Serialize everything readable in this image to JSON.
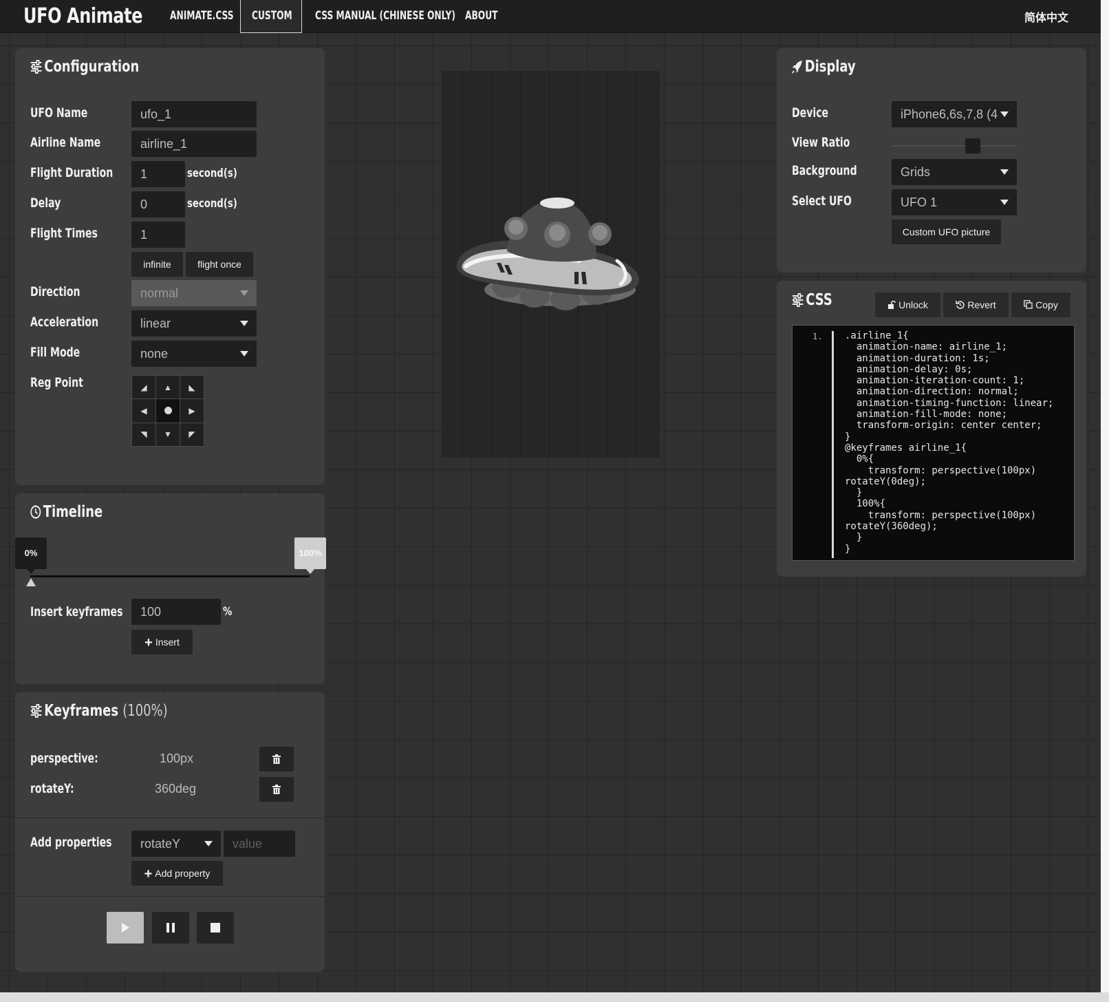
{
  "navbar": {
    "brand": "UFO Animate",
    "items": [
      "ANIMATE.CSS",
      "CUSTOM",
      "CSS MANUAL (CHINESE ONLY)",
      "ABOUT"
    ],
    "active": "CUSTOM",
    "language": "简体中文"
  },
  "configuration": {
    "title": "Configuration",
    "ufo_name": {
      "label": "UFO Name",
      "value": "ufo_1"
    },
    "airline_name": {
      "label": "Airline Name",
      "value": "airline_1"
    },
    "flight_duration": {
      "label": "Flight Duration",
      "value": "1",
      "unit": "second(s)"
    },
    "delay": {
      "label": "Delay",
      "value": "0",
      "unit": "second(s)"
    },
    "flight_times": {
      "label": "Flight Times",
      "value": "1",
      "infinite_label": "infinite",
      "once_label": "flight once"
    },
    "direction": {
      "label": "Direction",
      "value": "normal"
    },
    "acceleration": {
      "label": "Acceleration",
      "value": "linear"
    },
    "fill_mode": {
      "label": "Fill Mode",
      "value": "none"
    },
    "reg_point": {
      "label": "Reg Point",
      "selected": "center"
    }
  },
  "timeline": {
    "title": "Timeline",
    "start_label": "0%",
    "end_label": "100%",
    "selected_percent": 0,
    "insert_label": "Insert keyframes",
    "insert_value": "100",
    "insert_unit": "%",
    "insert_button": "Insert"
  },
  "keyframes": {
    "title": "Keyframes",
    "percent": "(100%)",
    "properties": [
      {
        "name": "perspective:",
        "value": "100px"
      },
      {
        "name": "rotateY:",
        "value": "360deg"
      }
    ],
    "add_label": "Add properties",
    "add_select": "rotateY",
    "add_placeholder": "value",
    "add_button": "Add property"
  },
  "playback": {
    "play_icon": "play-icon",
    "pause_icon": "pause-icon",
    "stop_icon": "stop-icon"
  },
  "display": {
    "title": "Display",
    "device": {
      "label": "Device",
      "value": "iPhone6,6s,7,8 (4"
    },
    "view_ratio": {
      "label": "View Ratio",
      "level": 0.65
    },
    "background": {
      "label": "Background",
      "value": "Grids"
    },
    "select_ufo": {
      "label": "Select UFO",
      "value": "UFO 1"
    },
    "custom_button": "Custom UFO picture"
  },
  "css_panel": {
    "title": "CSS",
    "unlock": "Unlock",
    "revert": "Revert",
    "copy": "Copy",
    "line_number": "1.",
    "code": ".airline_1{\n  animation-name: airline_1;\n  animation-duration: 1s;\n  animation-delay: 0s;\n  animation-iteration-count: 1;\n  animation-direction: normal;\n  animation-timing-function: linear;\n  animation-fill-mode: none;\n  transform-origin: center center;\n}\n@keyframes airline_1{\n  0%{\n    transform: perspective(100px)\nrotateY(0deg);\n  }\n  100%{\n    transform: perspective(100px)\nrotateY(360deg);\n  }\n}"
  }
}
